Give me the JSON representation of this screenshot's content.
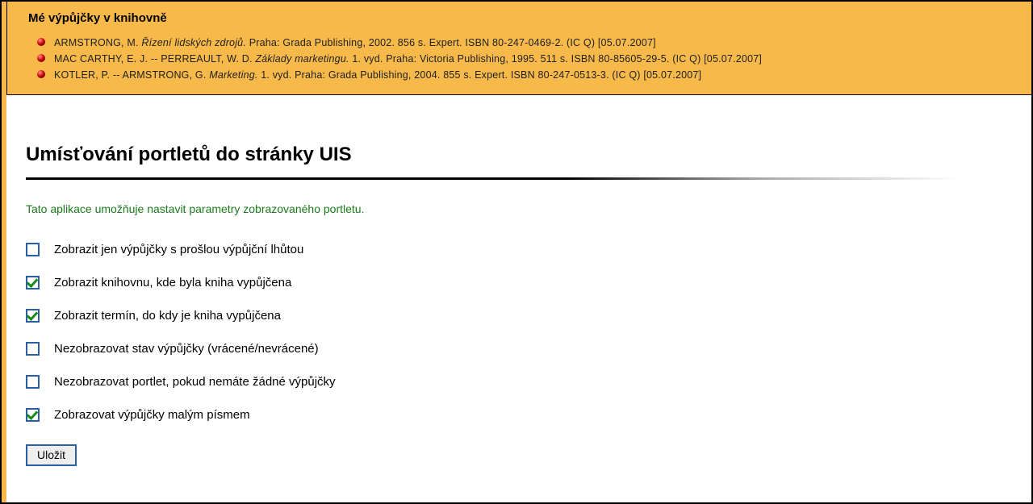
{
  "portlet": {
    "title": "Mé výpůjčky v knihovně",
    "loans": [
      {
        "author": "ARMSTRONG, M.",
        "title_italic": "Řízení lidských zdrojů.",
        "rest": " Praha: Grada Publishing, 2002. 856 s. Expert. ISBN 80-247-0469-2. (IC Q) [05.07.2007]"
      },
      {
        "author": "MAC CARTHY, E. J. -- PERREAULT, W. D.",
        "title_italic": "Základy marketingu.",
        "rest": " 1. vyd. Praha: Victoria Publishing, 1995. 511 s. ISBN 80-85605-29-5. (IC Q) [05.07.2007]"
      },
      {
        "author": "KOTLER, P. -- ARMSTRONG, G.",
        "title_italic": "Marketing.",
        "rest": " 1. vyd. Praha: Grada Publishing, 2004. 855 s. Expert. ISBN 80-247-0513-3. (IC Q) [05.07.2007]"
      }
    ]
  },
  "page": {
    "heading": "Umísťování portletů do stránky UIS",
    "intro": "Tato aplikace umožňuje nastavit parametry zobrazovaného portletu."
  },
  "options": [
    {
      "label": "Zobrazit jen výpůjčky s prošlou výpůjční lhůtou",
      "checked": false
    },
    {
      "label": "Zobrazit knihovnu, kde byla kniha vypůjčena",
      "checked": true
    },
    {
      "label": "Zobrazit termín, do kdy je kniha vypůjčena",
      "checked": true
    },
    {
      "label": "Nezobrazovat stav výpůjčky (vrácené/nevrácené)",
      "checked": false
    },
    {
      "label": "Nezobrazovat portlet, pokud nemáte žádné výpůjčky",
      "checked": false
    },
    {
      "label": "Zobrazovat výpůjčky malým písmem",
      "checked": true
    }
  ],
  "buttons": {
    "save": "Uložit"
  }
}
